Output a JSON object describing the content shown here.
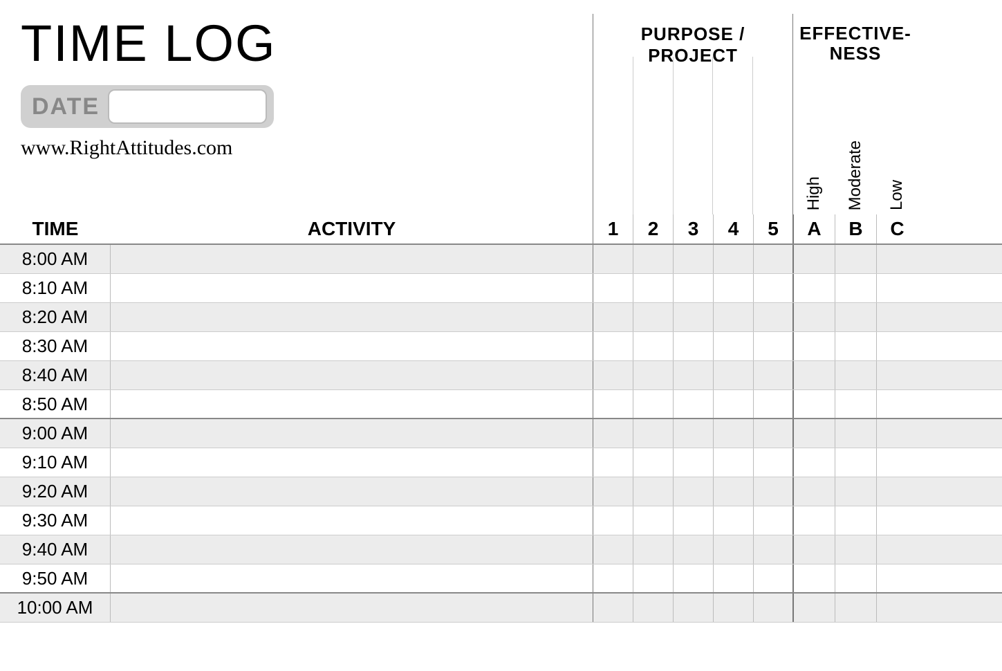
{
  "title": "TIME LOG",
  "date_label": "DATE",
  "website": "www.RightAttitudes.com",
  "headers": {
    "purpose": "PURPOSE / PROJECT",
    "effectiveness_line1": "EFFECTIVE-",
    "effectiveness_line2": "NESS",
    "time": "TIME",
    "activity": "ACTIVITY"
  },
  "purpose_cols": [
    "1",
    "2",
    "3",
    "4",
    "5"
  ],
  "effectiveness_labels": [
    "High",
    "Moderate",
    "Low"
  ],
  "effectiveness_cols": [
    "A",
    "B",
    "C"
  ],
  "times": [
    "8:00 AM",
    "8:10 AM",
    "8:20 AM",
    "8:30 AM",
    "8:40 AM",
    "8:50 AM",
    "9:00 AM",
    "9:10 AM",
    "9:20 AM",
    "9:30 AM",
    "9:40 AM",
    "9:50 AM",
    "10:00 AM"
  ]
}
